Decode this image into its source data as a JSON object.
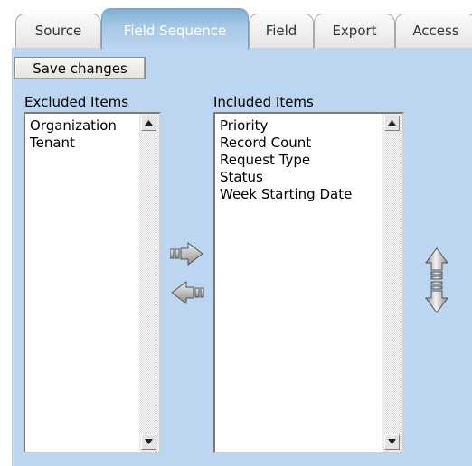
{
  "tabs": [
    {
      "label": "Source"
    },
    {
      "label": "Field Sequence"
    },
    {
      "label": "Field"
    },
    {
      "label": "Export"
    },
    {
      "label": "Access"
    }
  ],
  "toolbar": {
    "save_label": "Save changes"
  },
  "excluded": {
    "label": "Excluded Items",
    "items": [
      "Organization",
      "Tenant"
    ]
  },
  "included": {
    "label": "Included Items",
    "items": [
      "Priority",
      "Record Count",
      "Request Type",
      "Status",
      "Week Starting Date"
    ]
  },
  "colors": {
    "panel": "#bcd5f0",
    "active_tab": "#a9c9e8",
    "arrow_gray": "#9a9a9a"
  },
  "icons": {
    "move_right": "arrow-right-icon",
    "move_left": "arrow-left-icon",
    "move_up": "arrow-up-icon",
    "move_down": "arrow-down-icon"
  }
}
